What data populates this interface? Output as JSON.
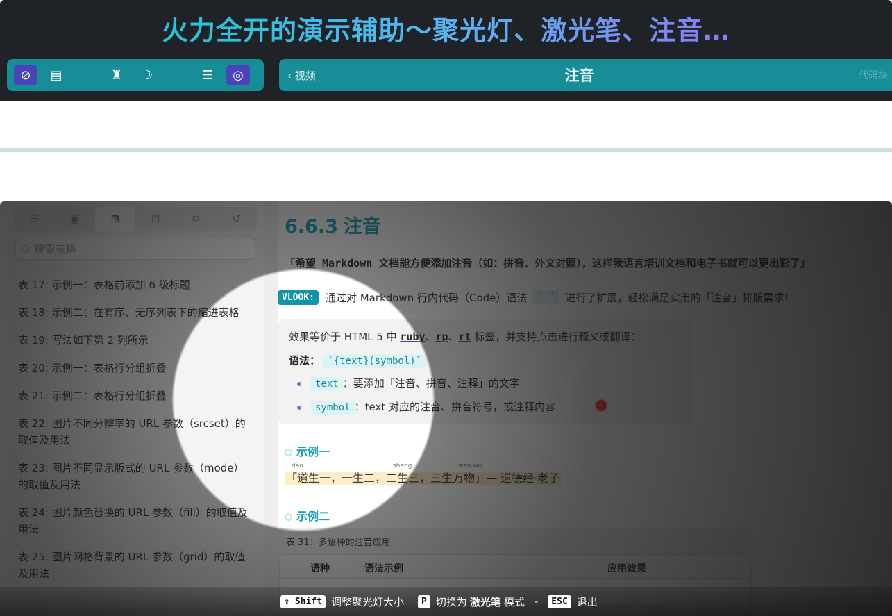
{
  "banner": {
    "title": "火力全开的演示辅助～聚光灯、激光笔、注音…",
    "mini_header": {
      "back": "‹ 视频",
      "title": "注音",
      "right": "代码块"
    }
  },
  "sidebar": {
    "search_placeholder": "搜索表格",
    "items": [
      "表 17: 示例一：表格前添加 6 级标题",
      "表 18: 示例二：在有序、无序列表下的缩进表格",
      "表 19: 写法如下第 2 列所示",
      "表 20: 示例一：表格行分组折叠",
      "表 21: 示例二：表格行分组折叠",
      "表 22: 图片不同分辨率的 URL 参数（srcset）的取值及用法",
      "表 23: 图片不同显示版式的 URL 参数（mode）的取值及用法",
      "表 24: 图片颜色替换的 URL 参数（fill）的取值及用法",
      "表 25: 图片网格背景的 URL 参数（grid）的取值及用法"
    ]
  },
  "content": {
    "heading_num": "6.6.3",
    "heading_text": "注音",
    "quote": "「希望 Markdown 文档能方便添加注音（如：拼音、外文对照），这样我语言培训文档和电子书就可以更出彩了」",
    "badge": "VLOOK:",
    "intro_a": "通过对 Markdown 行内代码（Code）语法",
    "intro_tick": "` `",
    "intro_b": "进行了扩展，轻松满足实用的「注音」排版需求！",
    "box_line1_a": "效果等价于 HTML 5 中",
    "tag_ruby": "ruby",
    "tag_rp": "rp",
    "tag_rt": "rt",
    "box_line1_b": "标签，并支持点击进行释义或翻译：",
    "syntax_label": "语法：",
    "syntax_code": "`{text}(symbol)`",
    "bullet1_code": "text",
    "bullet1_text": "：要添加「注音、拼音、注释」的文字",
    "bullet2_code": "symbol",
    "bullet2_text": "：text 对应的注音、拼音符号，或注释内容",
    "example1": "示例一",
    "ruby_sentence": "「道生一，一生二，二生三，三生万物」— 道德经·老子",
    "ruby_notes": [
      "dào",
      "shēng",
      "wàn wù"
    ],
    "example2": "示例二",
    "table_caption": "表 31：多语种的注音应用",
    "table_headers": [
      "语种",
      "语法示例",
      "应用效果"
    ]
  },
  "hint": {
    "key_shift": "⇧ Shift",
    "shift_text": "调整聚光灯大小",
    "key_p": "P",
    "p_text_a": "切换为",
    "p_text_b": "激光笔",
    "p_text_c": "模式",
    "dash": "-",
    "key_esc": "ESC",
    "esc_text": "退出"
  }
}
